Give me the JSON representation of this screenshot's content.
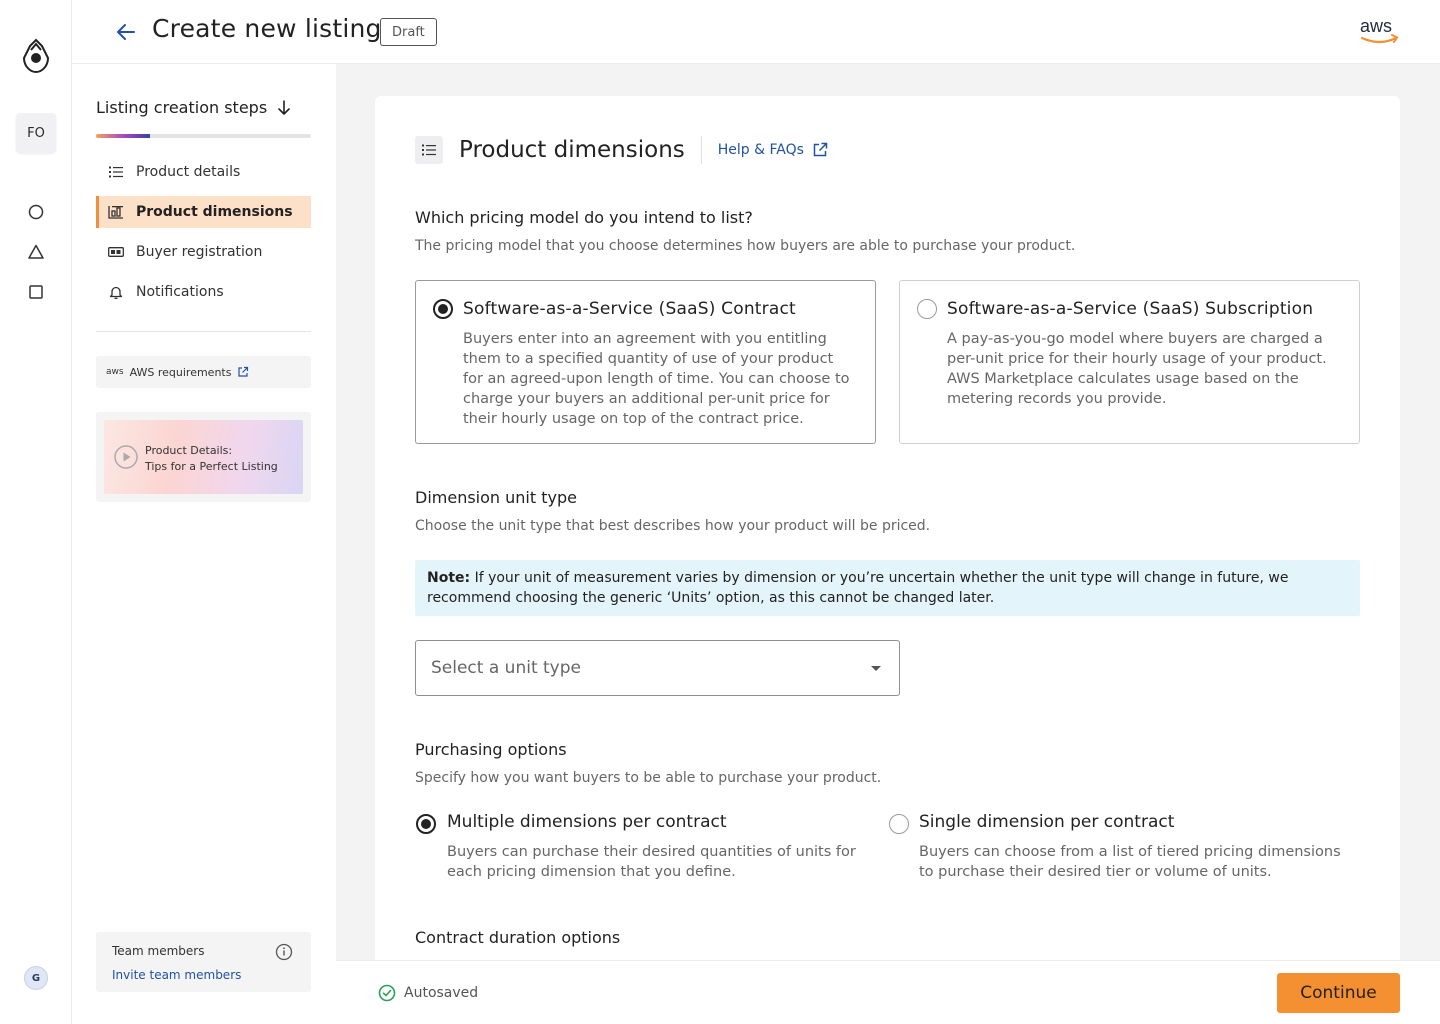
{
  "header": {
    "title": "Create new listing",
    "status_badge": "Draft",
    "brand_logo": "aws"
  },
  "rail": {
    "workspace_initials": "FO",
    "user_initial": "G",
    "icons": [
      "circle-icon",
      "triangle-icon",
      "square-icon"
    ]
  },
  "steps_panel": {
    "title": "Listing creation steps",
    "progress_fraction": 0.25,
    "items": [
      {
        "label": "Product details",
        "icon": "list-icon",
        "active": false
      },
      {
        "label": "Product dimensions",
        "icon": "dimensions-icon",
        "active": true
      },
      {
        "label": "Buyer registration",
        "icon": "registration-icon",
        "active": false
      },
      {
        "label": "Notifications",
        "icon": "bell-icon",
        "active": false
      }
    ],
    "aws_requirements": {
      "badge": "aws",
      "label": "AWS requirements"
    },
    "video": {
      "line1": "Product Details:",
      "line2": "Tips for a Perfect Listing"
    },
    "team": {
      "label": "Team members",
      "link": "Invite team members"
    }
  },
  "main": {
    "section_title": "Product dimensions",
    "help_link": "Help & FAQs",
    "pricing": {
      "question": "Which pricing model do you intend to list?",
      "subtext": "The pricing model that you choose determines how buyers are able to purchase your product.",
      "options": [
        {
          "title": "Software-as-a-Service (SaaS) Contract",
          "description": "Buyers enter into an agreement with you entitling them to a specified quantity of use of your product for an agreed-upon length of time. You can choose to charge your buyers an additional per-unit price for their hourly usage on top of the contract price.",
          "selected": true
        },
        {
          "title": "Software-as-a-Service (SaaS) Subscription",
          "description": "A pay-as-you-go model where buyers are charged a per-unit price for their hourly usage of your product. AWS Marketplace calculates usage based on the metering records you provide.",
          "selected": false
        }
      ]
    },
    "unit_type": {
      "question": "Dimension unit type",
      "subtext": "Choose the unit type that best describes how your product will be priced.",
      "note_label": "Note:",
      "note_text": " If your unit of measurement varies by dimension or you’re uncertain whether the unit type will change in future, we recommend choosing the generic ‘Units’ option, as this cannot be changed later.",
      "select_placeholder": "Select a unit type"
    },
    "purchasing": {
      "question": "Purchasing options",
      "subtext": "Specify how you want buyers to be able to purchase your product.",
      "options": [
        {
          "title": "Multiple dimensions per contract",
          "description": "Buyers can purchase their desired quantities of units for each pricing dimension that you define.",
          "selected": true
        },
        {
          "title": "Single dimension per contract",
          "description": "Buyers can choose from a list of tiered pricing dimensions to purchase their desired tier or volume of units.",
          "selected": false
        }
      ]
    },
    "contract_duration": {
      "question": "Contract duration options"
    }
  },
  "footer": {
    "autosave_status": "Autosaved",
    "continue_label": "Continue"
  },
  "colors": {
    "accent": "#f59032",
    "active_step_bg": "#fde0c8",
    "link": "#2152a3",
    "note_bg": "#e4f4fb"
  }
}
